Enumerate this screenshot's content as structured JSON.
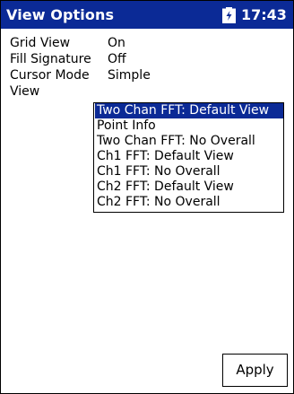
{
  "titlebar": {
    "title": "View Options",
    "time": "17:43",
    "battery_icon": "battery-charging-icon"
  },
  "settings": [
    {
      "label": "Grid View",
      "value": "On"
    },
    {
      "label": "Fill Signature",
      "value": "Off"
    },
    {
      "label": "Cursor Mode",
      "value": "Simple"
    },
    {
      "label": "View",
      "value": ""
    }
  ],
  "view_list": {
    "items": [
      "Two Chan FFT: Default View",
      "Point Info",
      "Two Chan FFT: No Overall",
      "Ch1 FFT: Default View",
      "Ch1 FFT: No Overall",
      "Ch2 FFT: Default View",
      "Ch2 FFT: No Overall"
    ],
    "selected": "Two Chan FFT: Default View"
  },
  "buttons": {
    "apply_label": "Apply"
  },
  "colors": {
    "titlebar": "#0b2a96",
    "selection": "#0b2a96",
    "background": "#ffffff",
    "text": "#000000"
  }
}
